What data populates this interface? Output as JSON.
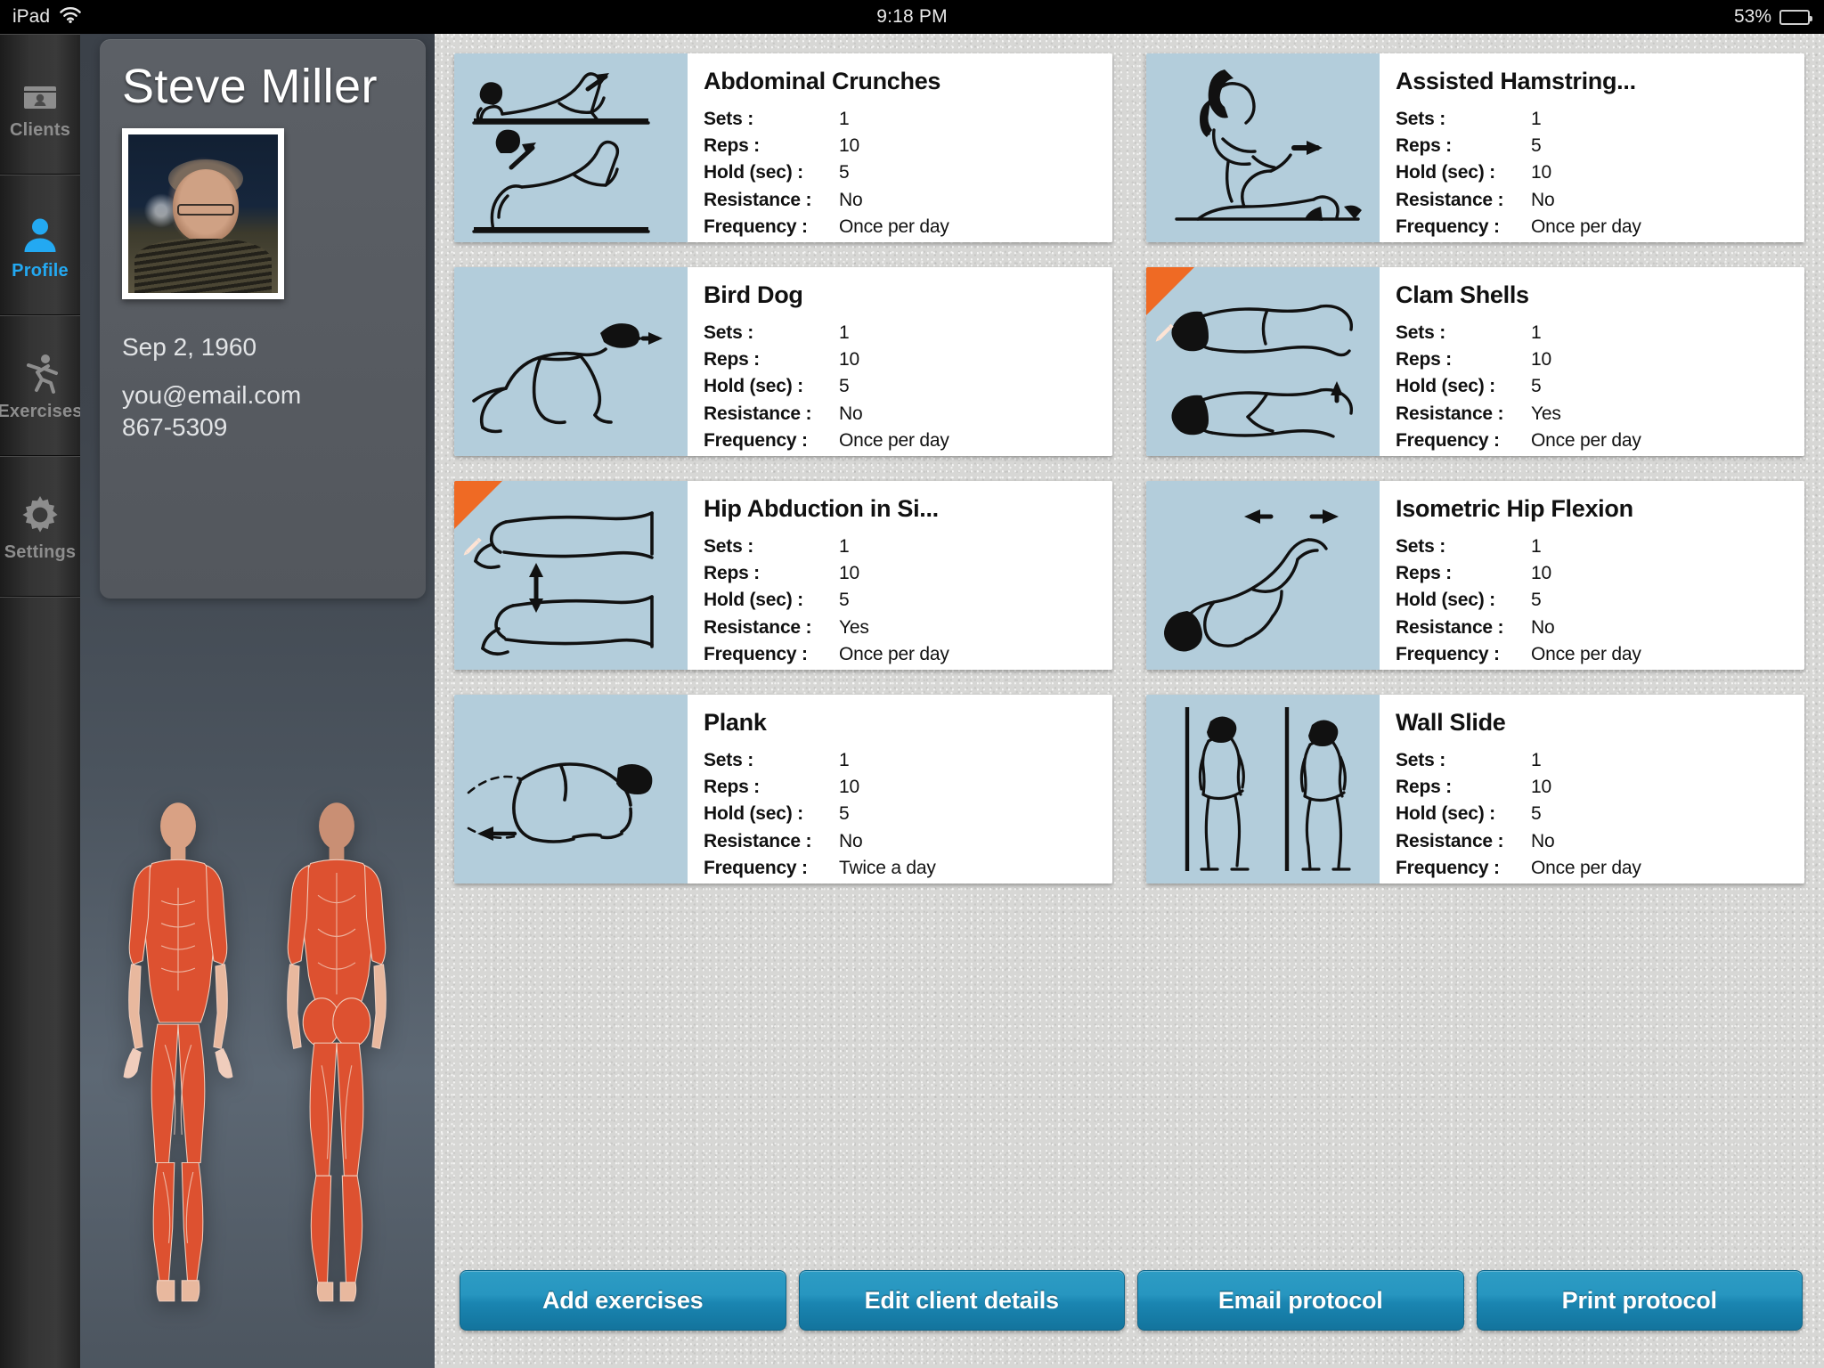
{
  "statusbar": {
    "device": "iPad",
    "wifi_icon": "wifi-icon",
    "time": "9:18 PM",
    "battery_percent": "53%",
    "battery_level": 53
  },
  "sidebar": {
    "items": [
      {
        "id": "clients",
        "label": "Clients",
        "icon": "clients-case-icon",
        "active": false
      },
      {
        "id": "profile",
        "label": "Profile",
        "icon": "person-icon",
        "active": true
      },
      {
        "id": "exercises",
        "label": "Exercises",
        "icon": "running-man-icon",
        "active": false
      },
      {
        "id": "settings",
        "label": "Settings",
        "icon": "gear-icon",
        "active": false
      }
    ],
    "active_color": "#23a9f2",
    "inactive_color": "#8d8d8d"
  },
  "profile": {
    "name": "Steve Miller",
    "photo_alt": "client-photo",
    "dob": "Sep 2, 1960",
    "email": "you@email.com",
    "phone": "867-5309",
    "anatomy_front_alt": "muscle-figure-front",
    "anatomy_back_alt": "muscle-figure-back",
    "muscle_highlight_color": "#e0512f"
  },
  "exercises": {
    "field_labels": {
      "sets": "Sets :",
      "reps": "Reps :",
      "hold": "Hold (sec) :",
      "resistance": "Resistance :",
      "frequency": "Frequency :"
    },
    "edit_badge_color": "#ef6a24",
    "illustration_bg": "#b3cddb",
    "items": [
      {
        "title": "Abdominal Crunches",
        "illustration": "abdominal-crunches-illustration",
        "edit_badge": false,
        "sets": "1",
        "reps": "10",
        "hold": "5",
        "resistance": "No",
        "frequency": "Once per day"
      },
      {
        "title": "Assisted Hamstring...",
        "illustration": "assisted-hamstring-stretch-illustration",
        "edit_badge": false,
        "sets": "1",
        "reps": "5",
        "hold": "10",
        "resistance": "No",
        "frequency": "Once per day"
      },
      {
        "title": "Bird Dog",
        "illustration": "bird-dog-illustration",
        "edit_badge": false,
        "sets": "1",
        "reps": "10",
        "hold": "5",
        "resistance": "No",
        "frequency": "Once per day"
      },
      {
        "title": "Clam Shells",
        "illustration": "clam-shells-illustration",
        "edit_badge": true,
        "sets": "1",
        "reps": "10",
        "hold": "5",
        "resistance": "Yes",
        "frequency": "Once per day"
      },
      {
        "title": "Hip Abduction in Si...",
        "illustration": "hip-abduction-sidelying-illustration",
        "edit_badge": true,
        "sets": "1",
        "reps": "10",
        "hold": "5",
        "resistance": "Yes",
        "frequency": "Once per day"
      },
      {
        "title": "Isometric Hip Flexion",
        "illustration": "isometric-hip-flexion-illustration",
        "edit_badge": false,
        "sets": "1",
        "reps": "10",
        "hold": "5",
        "resistance": "No",
        "frequency": "Once per day"
      },
      {
        "title": "Plank",
        "illustration": "plank-illustration",
        "edit_badge": false,
        "sets": "1",
        "reps": "10",
        "hold": "5",
        "resistance": "No",
        "frequency": "Twice a day"
      },
      {
        "title": "Wall Slide",
        "illustration": "wall-slide-illustration",
        "edit_badge": false,
        "sets": "1",
        "reps": "10",
        "hold": "5",
        "resistance": "No",
        "frequency": "Once per day"
      }
    ]
  },
  "toolbar": {
    "buttons": [
      {
        "id": "add-exercises",
        "label": "Add exercises"
      },
      {
        "id": "edit-client-details",
        "label": "Edit client details"
      },
      {
        "id": "email-protocol",
        "label": "Email protocol"
      },
      {
        "id": "print-protocol",
        "label": "Print protocol"
      }
    ],
    "accent_color": "#1f8fb8"
  }
}
